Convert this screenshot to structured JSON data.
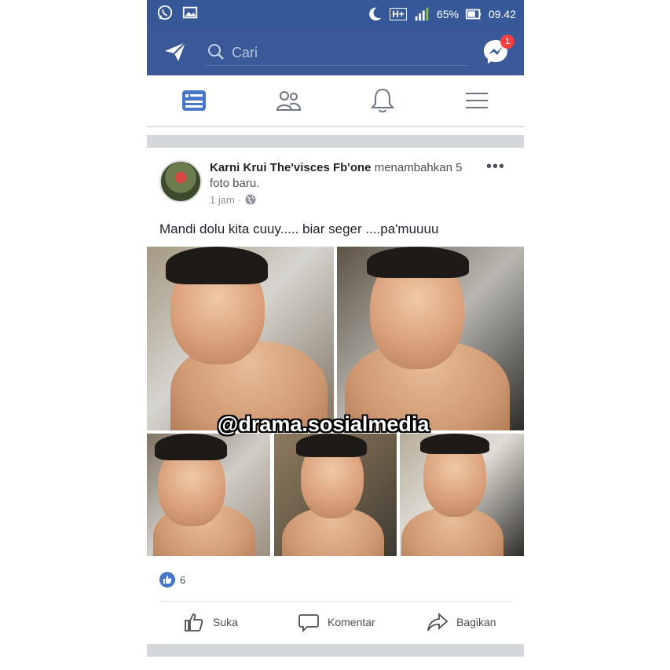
{
  "status_bar": {
    "battery": "65%",
    "time": "09.42",
    "network": "H+",
    "icons": [
      "whatsapp-icon",
      "image-icon",
      "moon-icon",
      "signal-icon",
      "battery-icon"
    ]
  },
  "header": {
    "search_placeholder": "Cari",
    "messenger_badge": "1",
    "accent": "#3b5998"
  },
  "tabs": [
    "news-feed-icon",
    "friends-icon",
    "notifications-icon",
    "menu-icon"
  ],
  "post": {
    "author": "Karni Krui The'visces Fb'one",
    "action_text": " menambahkan 5 foto baru.",
    "time": "1 jam",
    "dot": "·",
    "caption": "Mandi dolu kita cuuy..... biar seger ....pa'muuuu",
    "watermark": "@drama.sosialmedia",
    "like_count": "6",
    "more": "•••",
    "actions": {
      "like": "Suka",
      "comment": "Komentar",
      "share": "Bagikan"
    }
  }
}
